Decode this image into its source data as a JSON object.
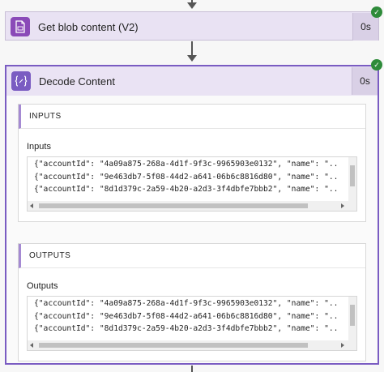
{
  "flow": {
    "blob_step": {
      "title": "Get blob content (V2)",
      "duration": "0s",
      "icon": "blob-file-icon"
    },
    "decode_step": {
      "title": "Decode Content",
      "duration": "0s",
      "icon": "curly-braces-icon",
      "inputs": {
        "header": "INPUTS",
        "label": "Inputs",
        "lines": [
          "{\"accountId\": \"4a09a875-268a-4d1f-9f3c-9965903e0132\", \"name\": \"..",
          "{\"accountId\": \"9e463db7-5f08-44d2-a641-06b6c8816d80\", \"name\": \"..",
          "{\"accountId\": \"8d1d379c-2a59-4b20-a2d3-3f4dbfe7bbb2\", \"name\": \".."
        ]
      },
      "outputs": {
        "header": "OUTPUTS",
        "label": "Outputs",
        "lines": [
          "{\"accountId\": \"4a09a875-268a-4d1f-9f3c-9965903e0132\", \"name\": \"..",
          "{\"accountId\": \"9e463db7-5f08-44d2-a641-06b6c8816d80\", \"name\": \"..",
          "{\"accountId\": \"8d1d379c-2a59-4b20-a2d3-3f4dbfe7bbb2\", \"name\": \".."
        ]
      }
    },
    "status_icon": "check-icon",
    "colors": {
      "accent": "#7a5cc2",
      "blob_icon_bg": "#8a4ab8",
      "success": "#2e8b3a"
    }
  }
}
